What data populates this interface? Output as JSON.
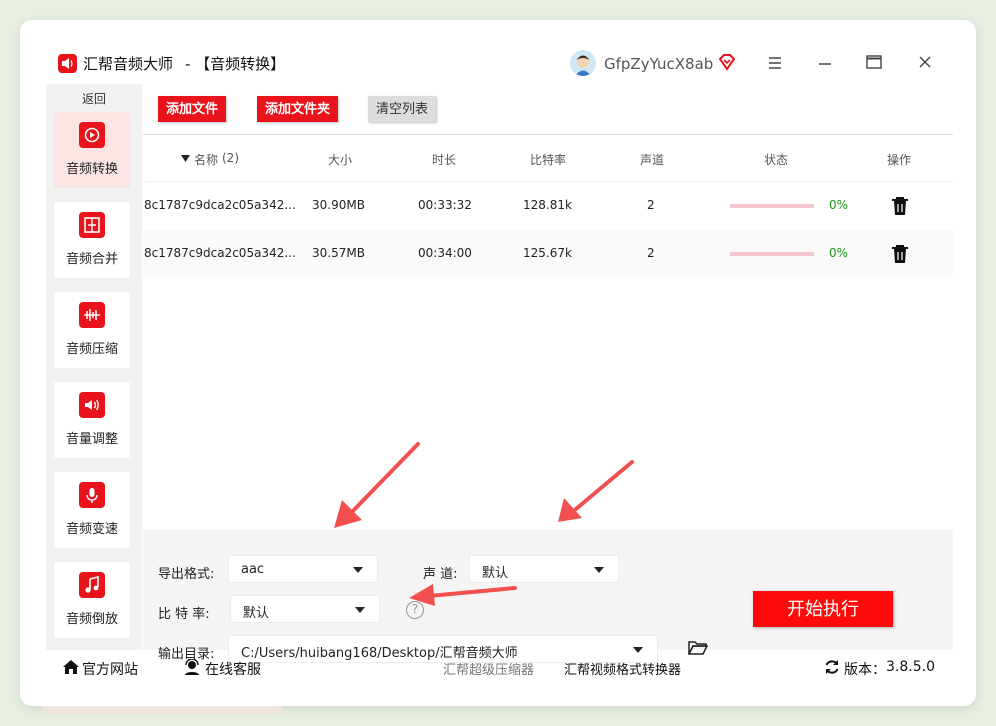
{
  "app": {
    "name": "汇帮音频大师",
    "title": "-  【音频转换】",
    "user": "GfpZyYucX8ab"
  },
  "sidebar": {
    "back": "返回",
    "items": [
      {
        "label": "音频转换",
        "icon": "audio-convert-icon"
      },
      {
        "label": "音频合并",
        "icon": "audio-merge-icon"
      },
      {
        "label": "音频压缩",
        "icon": "audio-compress-icon"
      },
      {
        "label": "音量调整",
        "icon": "volume-icon"
      },
      {
        "label": "音频变速",
        "icon": "microphone-icon"
      },
      {
        "label": "音频倒放",
        "icon": "music-note-icon"
      }
    ]
  },
  "toolbar": {
    "add_file": "添加文件",
    "add_folder": "添加文件夹",
    "clear_list": "清空列表"
  },
  "table": {
    "headers": {
      "name": "名称",
      "count": "(2)",
      "size": "大小",
      "duration": "时长",
      "bitrate": "比特率",
      "channels": "声道",
      "status": "状态",
      "action": "操作"
    },
    "rows": [
      {
        "name": "8c1787c9dca2c05a342...",
        "size": "30.90MB",
        "duration": "00:33:32",
        "bitrate": "128.81k",
        "channels": "2",
        "percent": "0%",
        "progress": 0
      },
      {
        "name": "8c1787c9dca2c05a342...",
        "size": "30.57MB",
        "duration": "00:34:00",
        "bitrate": "125.67k",
        "channels": "2",
        "percent": "0%",
        "progress": 0
      }
    ]
  },
  "settings": {
    "format_label": "导出格式:",
    "format_value": "aac",
    "channel_label": "声  道:",
    "channel_value": "默认",
    "bitrate_label": "比 特 率:",
    "bitrate_value": "默认",
    "output_label": "输出目录:",
    "output_value": "C:/Users/huibang168/Desktop/汇帮音频大师",
    "start": "开始执行",
    "help": "?"
  },
  "footer": {
    "website": "官方网站",
    "service": "在线客服",
    "compressor": "汇帮超级压缩器",
    "converter": "汇帮视频格式转换器",
    "version_label": "版本：",
    "version": "3.8.5.0"
  },
  "colors": {
    "accent": "#e8131b",
    "progress_track": "#f4c6d0",
    "percent": "#1a9a1a",
    "arrow": "#f25050"
  }
}
